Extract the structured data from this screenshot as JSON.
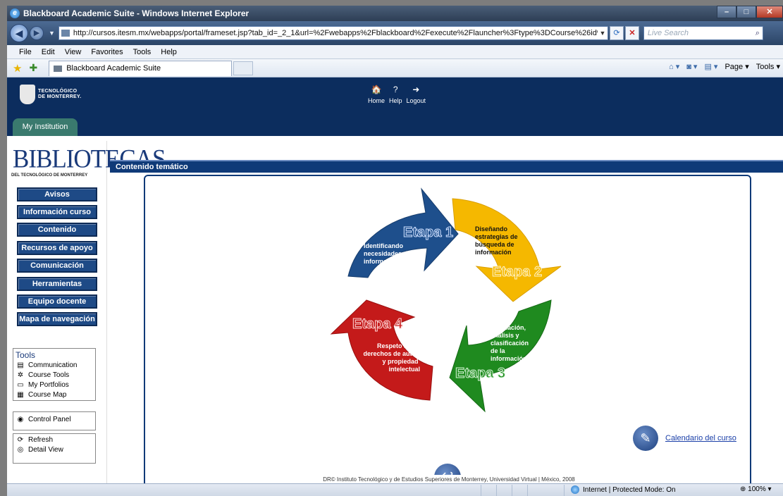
{
  "window": {
    "title": "Blackboard Academic Suite - Windows Internet Explorer",
    "controls": [
      "–",
      "□",
      "✕"
    ]
  },
  "address": {
    "url": "http://cursos.itesm.mx/webapps/portal/frameset.jsp?tab_id=_2_1&url=%2Fwebapps%2Fblackboard%2Fexecute%2Flauncher%3Ftype%3DCourse%26id%3D_173157",
    "search_placeholder": "Live Search"
  },
  "menu": [
    "File",
    "Edit",
    "View",
    "Favorites",
    "Tools",
    "Help"
  ],
  "tab": {
    "label": "Blackboard Academic Suite"
  },
  "commandbar": {
    "page": "Page ▾",
    "tools": "Tools ▾"
  },
  "header": {
    "logo_line1": "TECNOLÓGICO",
    "logo_line2": "DE MONTERREY.",
    "links": [
      {
        "icon": "home-icon",
        "glyph": "🏠",
        "label": "Home"
      },
      {
        "icon": "help-icon",
        "glyph": "?",
        "label": "Help"
      },
      {
        "icon": "logout-icon",
        "glyph": "➜",
        "label": "Logout"
      }
    ],
    "tab_label": "My Institution"
  },
  "sidebar": {
    "brand": "BIBLIOTECAS",
    "brand_sub": "DEL TECNOLÓGICO DE MONTERREY",
    "buttons": [
      "Avisos",
      "Información curso",
      "Contenido",
      "Recursos de apoyo",
      "Comunicación",
      "Herramientas",
      "Equipo docente",
      "Mapa de navegación"
    ],
    "tools_title": "Tools",
    "tools": [
      "Communication",
      "Course Tools",
      "My Portfolios",
      "Course Map"
    ],
    "control_panel": "Control Panel",
    "refresh": "Refresh",
    "detail_view": "Detail View"
  },
  "main": {
    "section_title": "Contenido temático",
    "stages": [
      {
        "title": "Etapa 1",
        "text": "Identificando necesidades de información",
        "color": "#1e4f8c"
      },
      {
        "title": "Etapa 2",
        "text": "Diseñando estrategias de búsqueda de información",
        "color": "#f5b800"
      },
      {
        "title": "Etapa 3",
        "text": "Evaluación, análisis y clasificación de la información",
        "color": "#1f8a1f"
      },
      {
        "title": "Etapa 4",
        "text": "Respeto a los derechos de autor y propiedad intelectual",
        "color": "#c41a1a"
      }
    ],
    "calendar_link": "Calendario del curso",
    "footer": "DR© Instituto Tecnológico y de Estudios Superiores de Monterrey, Universidad Virtual | México, 2008"
  },
  "status": {
    "zone": "Internet | Protected Mode: On",
    "zoom": "100%"
  }
}
